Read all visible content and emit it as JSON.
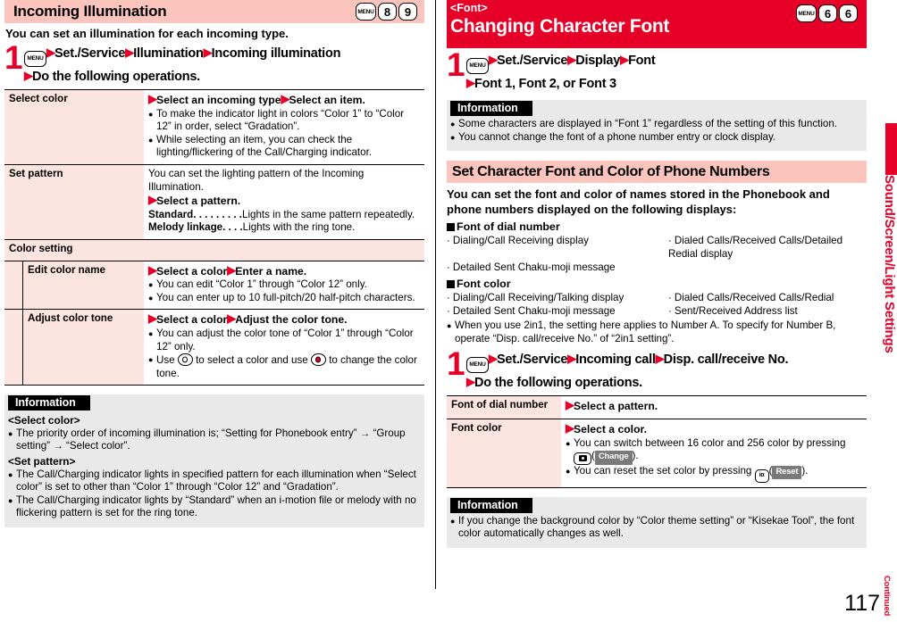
{
  "left": {
    "title": "Incoming Illumination",
    "keys": [
      "MENU",
      "8",
      "9"
    ],
    "lead": "You can set an illumination for each incoming type.",
    "step": {
      "number": "1",
      "menu_key": "MENU",
      "line1_parts": [
        "Set./Service",
        "Illumination",
        "Incoming illumination"
      ],
      "line2": "Do the following operations."
    },
    "table": {
      "rows": [
        {
          "label": "Select color",
          "head": "Select an incoming type▶Select an item.",
          "head_parts": [
            "Select an incoming type",
            "Select an item."
          ],
          "bullets": [
            "To make the indicator light in colors “Color 1” to “Color 12” in order, select “Gradation”.",
            "While selecting an item, you can check the lighting/flickering of the Call/Charging indicator."
          ]
        },
        {
          "label": "Set pattern",
          "intro": "You can set the lighting pattern of the Incoming Illumination.",
          "head_parts": [
            "Select a pattern."
          ],
          "defs": [
            {
              "term": "Standard",
              "leader": ". . . . . . . . .",
              "desc": "Lights in the same pattern repeatedly."
            },
            {
              "term": "Melody linkage",
              "leader": ". . . .",
              "desc": "Lights with the ring tone."
            }
          ]
        }
      ],
      "group_header": "Color setting",
      "subrows": [
        {
          "label": "Edit color name",
          "head_parts": [
            "Select a color",
            "Enter a name."
          ],
          "bullets": [
            "You can edit “Color 1” through “Color 12” only.",
            "You can enter up to 10 full-pitch/20 half-pitch characters."
          ]
        },
        {
          "label": "Adjust color tone",
          "head_parts": [
            "Select a color",
            "Adjust the color tone."
          ],
          "bullets": [
            "You can adjust the color tone of “Color 1” through “Color 12” only."
          ],
          "bullet_nav_pre": "Use ",
          "bullet_nav_mid": " to select a color and use ",
          "bullet_nav_post": " to change the color tone."
        }
      ]
    },
    "information": {
      "tab": "Information",
      "sub1": "<Select color>",
      "bullets1": [
        "The priority order of incoming illumination is; “Setting for Phonebook entry” → “Group setting” → “Select color”."
      ],
      "sub2": "<Set pattern>",
      "bullets2": [
        "The Call/Charging indicator lights in specified pattern for each illumination when “Select color” is set to other than “Color 1” through “Color 12” and “Gradation”.",
        "The Call/Charging indicator lights by “Standard” when an i-motion file or melody with no flickering pattern is set for the ring tone."
      ]
    }
  },
  "right": {
    "title_sub": "<Font>",
    "title_main": "Changing Character Font",
    "keys": [
      "MENU",
      "6",
      "6"
    ],
    "step1": {
      "number": "1",
      "menu_key": "MENU",
      "line1_parts": [
        "Set./Service",
        "Display",
        "Font"
      ],
      "line2": "Font 1, Font 2, or Font 3"
    },
    "information1": {
      "tab": "Information",
      "bullets": [
        "Some characters are displayed in “Font 1” regardless of the setting of this function.",
        "You cannot change the font of a phone number entry or clock display."
      ]
    },
    "section2_title": "Set Character Font and Color of Phone Numbers",
    "section2_lead": "You can set the font and color of names stored in the Phonebook and phone numbers displayed on the following displays:",
    "group_font_dial": {
      "heading": "Font of dial number",
      "items": [
        "Dialing/Call Receiving display",
        "Dialed Calls/Received Calls/Detailed Redial display",
        "Detailed Sent Chaku-moji message"
      ]
    },
    "group_font_color": {
      "heading": "Font color",
      "items": [
        "Dialing/Call Receiving/Talking display",
        "Dialed Calls/Received Calls/Redial",
        "Detailed Sent Chaku-moji message",
        "Sent/Received Address list"
      ]
    },
    "note_bullet": "When you use 2in1, the setting here applies to Number A. To specify for Number B, operate “Disp. call/receive No.” of “2in1 setting”.",
    "step2": {
      "number": "1",
      "menu_key": "MENU",
      "line1_parts": [
        "Set./Service",
        "Incoming call",
        "Disp. call/receive No."
      ],
      "line2": "Do the following operations."
    },
    "table": {
      "rows": [
        {
          "label": "Font of dial number",
          "head_parts": [
            "Select a pattern."
          ]
        },
        {
          "label": "Font color",
          "head_parts": [
            "Select a color."
          ],
          "bullet1_pre": "You can switch between 16 color and 256 color by pressing ",
          "bullet1_btn": "Change",
          "bullet1_post": ".",
          "bullet2_pre": "You can reset the set color by pressing ",
          "bullet2_btn": "Reset",
          "bullet2_post": "."
        }
      ]
    },
    "information2": {
      "tab": "Information",
      "bullets": [
        "If you change the background color by “Color theme setting” or “Kisekae Tool”, the font color automatically changes as well."
      ]
    }
  },
  "sidebar": {
    "label": "Sound/Screen/Light Settings"
  },
  "footer": {
    "page": "117",
    "continued": "Continued"
  },
  "colors": {
    "accent_red": "#e60027",
    "title_pink": "#fbc4bd",
    "cell_pink": "#fce5e1",
    "info_grey": "#e9e9e9"
  }
}
